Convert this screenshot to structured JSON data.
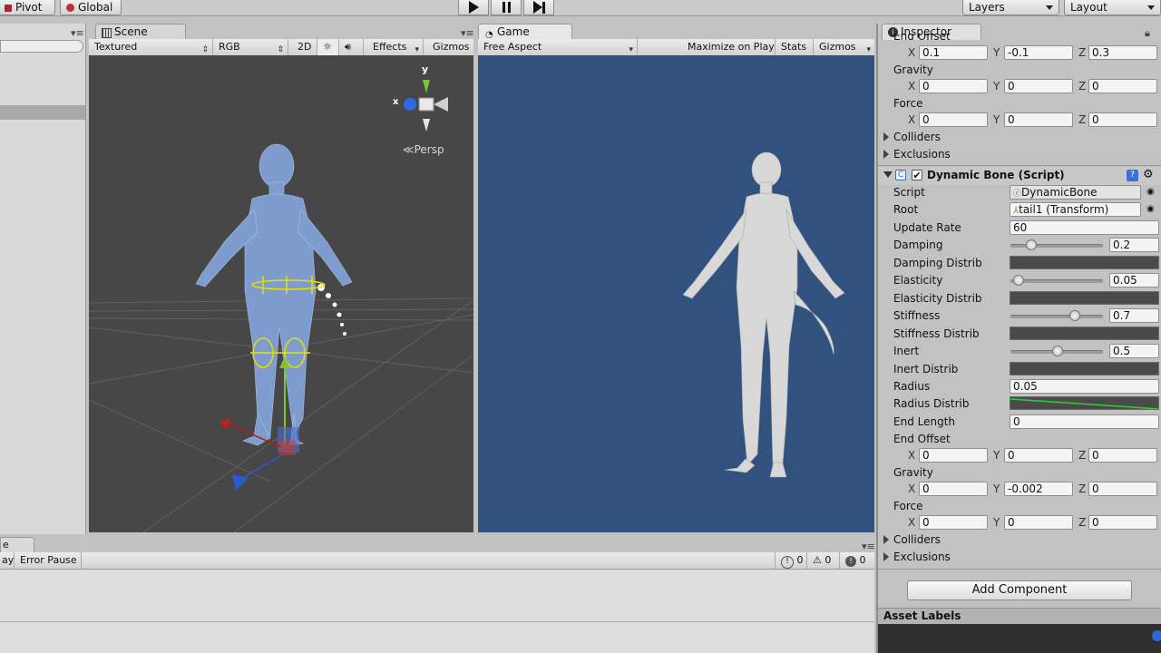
{
  "toolbar": {
    "pivot_label": "Pivot",
    "global_label": "Global",
    "layers_label": "Layers",
    "layout_label": "Layout"
  },
  "scene": {
    "tab_label": "Scene",
    "shading_mode": "Textured",
    "color_mode": "RGB",
    "mode_2d": "2D",
    "effects_label": "Effects",
    "gizmos_label": "Gizmos",
    "persp_label": "Persp",
    "axis_y": "y",
    "axis_x": "x"
  },
  "game": {
    "tab_label": "Game",
    "aspect": "Free Aspect",
    "maximize_label": "Maximize on Play",
    "stats_label": "Stats",
    "gizmos_label": "Gizmos"
  },
  "console": {
    "clear_on_play_label": "ay",
    "error_pause_label": "Error Pause",
    "tab_label": "e",
    "log_count": "0",
    "warning_count": "0",
    "error_count": "0"
  },
  "inspector": {
    "tab_label": "Inspector",
    "clipped_label": "End Offset",
    "top_end_offset": {
      "x": "0.1",
      "y": "-0.1",
      "z": "0.3"
    },
    "top_gravity_label": "Gravity",
    "top_gravity": {
      "x": "0",
      "y": "0",
      "z": "0"
    },
    "top_force_label": "Force",
    "top_force": {
      "x": "0",
      "y": "0",
      "z": "0"
    },
    "top_colliders_label": "Colliders",
    "top_exclusions_label": "Exclusions",
    "component_title": "Dynamic Bone (Script)",
    "script_label": "Script",
    "script_value": "DynamicBone",
    "root_label": "Root",
    "root_value": "tail1 (Transform)",
    "update_rate_label": "Update Rate",
    "update_rate_value": "60",
    "damping_label": "Damping",
    "damping_value": "0.2",
    "damping_fraction": 0.2,
    "damping_distrib_label": "Damping Distrib",
    "elasticity_label": "Elasticity",
    "elasticity_value": "0.05",
    "elasticity_fraction": 0.05,
    "elasticity_distrib_label": "Elasticity Distrib",
    "stiffness_label": "Stiffness",
    "stiffness_value": "0.7",
    "stiffness_fraction": 0.7,
    "stiffness_distrib_label": "Stiffness Distrib",
    "inert_label": "Inert",
    "inert_value": "0.5",
    "inert_fraction": 0.5,
    "inert_distrib_label": "Inert Distrib",
    "radius_label": "Radius",
    "radius_value": "0.05",
    "radius_distrib_label": "Radius Distrib",
    "end_length_label": "End Length",
    "end_length_value": "0",
    "end_offset_label": "End Offset",
    "end_offset": {
      "x": "0",
      "y": "0",
      "z": "0"
    },
    "gravity_label": "Gravity",
    "gravity": {
      "x": "0",
      "y": "-0.002",
      "z": "0"
    },
    "force_label": "Force",
    "force": {
      "x": "0",
      "y": "0",
      "z": "0"
    },
    "colliders_label": "Colliders",
    "exclusions_label": "Exclusions",
    "add_component_label": "Add Component",
    "asset_labels_label": "Asset Labels",
    "axis_x": "X",
    "axis_y": "Y",
    "axis_z": "Z"
  },
  "colors": {
    "scene_bg": "#474747",
    "game_bg": "#31527e",
    "mesh_blue": "#7f9ccf",
    "gizmo_yellow": "#e8e000",
    "body_gray": "#d8d8d8"
  }
}
